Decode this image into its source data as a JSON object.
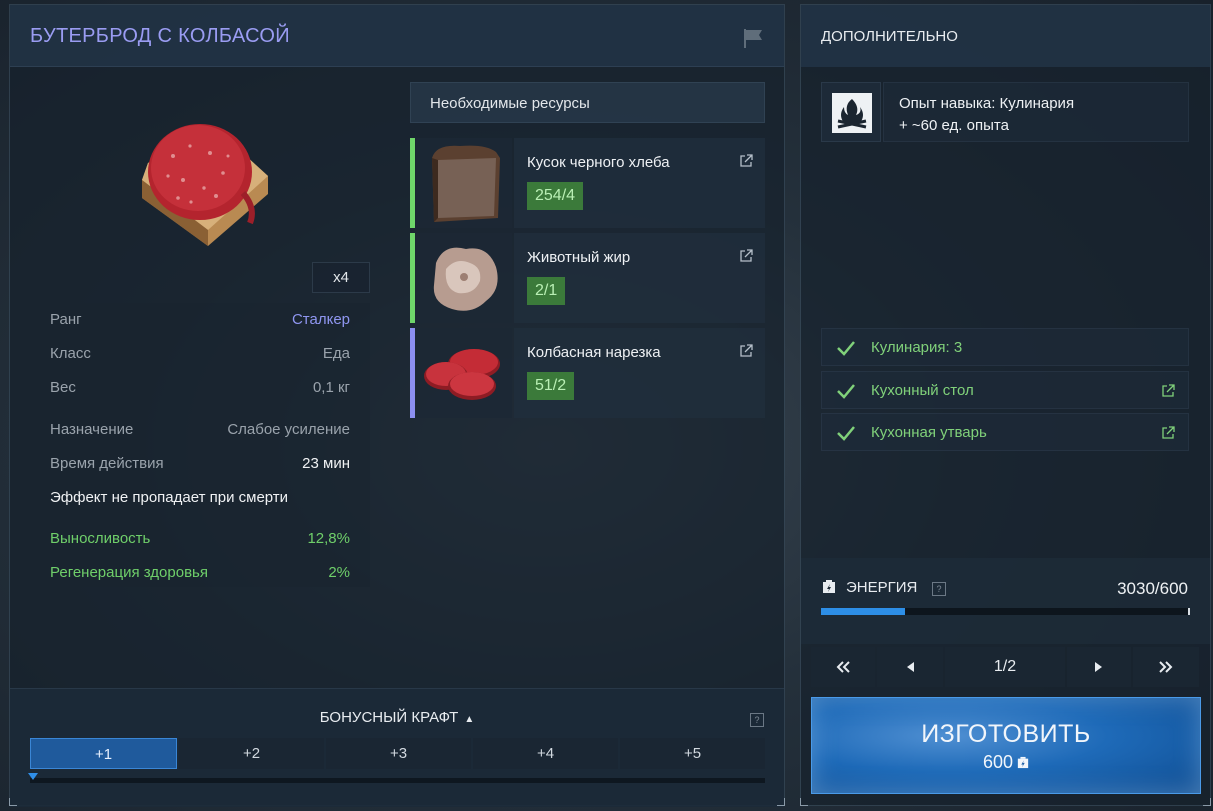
{
  "item": {
    "title": "БУТЕРБРОД С КОЛБАСОЙ",
    "quantity": "x4",
    "stats": [
      {
        "label": "Ранг",
        "value": "Сталкер"
      },
      {
        "label": "Класс",
        "value": "Еда"
      },
      {
        "label": "Вес",
        "value": "0,1 кг"
      },
      {
        "label": "Назначение",
        "value": "Слабое усиление"
      },
      {
        "label": "Время действия",
        "value": "23 мин"
      }
    ],
    "note": "Эффект не пропадает при смерти",
    "effects": [
      {
        "label": "Выносливость",
        "value": "12,8%"
      },
      {
        "label": "Регенерация здоровья",
        "value": "2%"
      }
    ]
  },
  "resources": {
    "header": "Необходимые ресурсы",
    "items": [
      {
        "name": "Кусок черного хлеба",
        "count": "254/4",
        "bar_color": "#6fd66a"
      },
      {
        "name": "Животный жир",
        "count": "2/1",
        "bar_color": "#6fd66a"
      },
      {
        "name": "Колбасная нарезка",
        "count": "51/2",
        "bar_color": "#8c8ff0"
      }
    ]
  },
  "bonus": {
    "title": "БОНУСНЫЙ КРАФТ",
    "help": "?",
    "tabs": [
      "+1",
      "+2",
      "+3",
      "+4",
      "+5"
    ],
    "active_tab": 0
  },
  "extra": {
    "title": "ДОПОЛНИТЕЛЬНО",
    "skill_line1": "Опыт навыка: Кулинария",
    "skill_line2": "+ ~60 ед. опыта",
    "requirements": [
      {
        "label": "Кулинария: 3",
        "external": false
      },
      {
        "label": "Кухонный стол",
        "external": true
      },
      {
        "label": "Кухонная утварь",
        "external": true
      }
    ]
  },
  "energy": {
    "label": "ЭНЕРГИЯ",
    "help": "?",
    "value": "3030/600",
    "bar_fraction": 0.23
  },
  "pager": {
    "page": "1/2"
  },
  "craft": {
    "label": "ИЗГОТОВИТЬ",
    "cost": "600"
  },
  "colors": {
    "title": "#9a9cf2",
    "green": "#6fcf6a",
    "accent_blue": "#2d8ee6"
  }
}
